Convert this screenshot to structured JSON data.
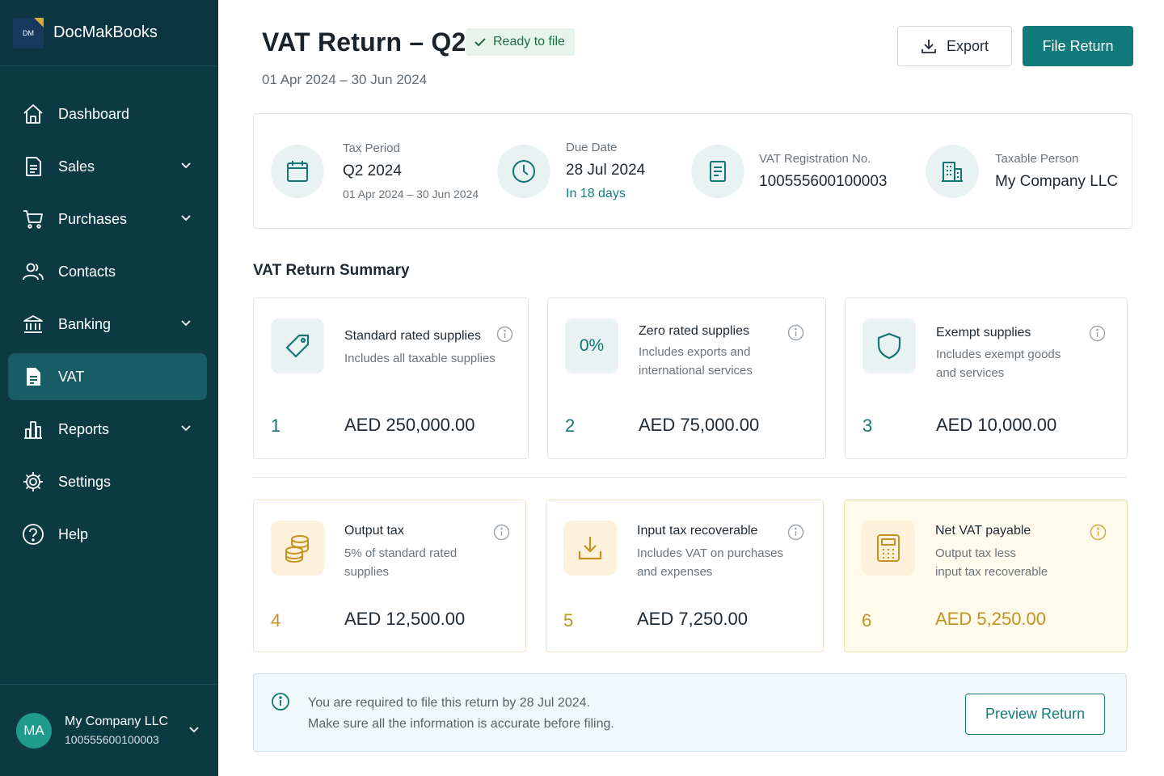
{
  "brand": {
    "logo_text": "DM",
    "name": "DocMakBooks"
  },
  "sidebar": {
    "items": [
      {
        "label": "Dashboard",
        "icon": "home-icon"
      },
      {
        "label": "Sales",
        "icon": "document-icon",
        "has_submenu": true
      },
      {
        "label": "Purchases",
        "icon": "cart-icon",
        "has_submenu": true
      },
      {
        "label": "Contacts",
        "icon": "users-icon"
      },
      {
        "label": "Banking",
        "icon": "bank-icon",
        "has_submenu": true
      },
      {
        "label": "VAT",
        "icon": "file-icon",
        "active": true
      },
      {
        "label": "Reports",
        "icon": "bar-chart-icon",
        "has_submenu": true
      },
      {
        "label": "Settings",
        "icon": "gear-icon"
      },
      {
        "label": "Help",
        "icon": "help-icon"
      }
    ],
    "user": {
      "initials": "MA",
      "name": "My Company LLC",
      "trn": "100555600100003"
    }
  },
  "header": {
    "title": "VAT Return – Q2",
    "status": "Ready to file",
    "period": "01 Apr 2024 – 30 Jun 2024",
    "export_label": "Export",
    "file_label": "File Return"
  },
  "info": {
    "tax_period": {
      "label": "Tax Period",
      "value": "Q2 2024",
      "sub": "01 Apr 2024 – 30 Jun 2024"
    },
    "due_date": {
      "label": "Due Date",
      "value": "28 Jul 2024",
      "sub": "In 18 days"
    },
    "vat_reg": {
      "label": "VAT Registration No.",
      "value": "100555600100003"
    },
    "taxable_person": {
      "label": "Taxable Person",
      "value": "My Company LLC"
    }
  },
  "summary": {
    "title": "VAT Return Summary",
    "cards": [
      {
        "num": "1",
        "title": "Standard rated supplies",
        "desc1": "Includes all taxable supplies",
        "desc2": "",
        "currency": "AED",
        "amount": "250,000.00"
      },
      {
        "num": "2",
        "title": "Zero rated supplies",
        "desc1": "Includes exports and",
        "desc2": "international services",
        "icon_text": "0%",
        "currency": "AED",
        "amount": "75,000.00"
      },
      {
        "num": "3",
        "title": "Exempt supplies",
        "desc1": "Includes exempt goods",
        "desc2": "and services",
        "currency": "AED",
        "amount": "10,000.00"
      },
      {
        "num": "4",
        "title": "Output tax",
        "desc1": "5% of standard rated",
        "desc2": "supplies",
        "currency": "AED",
        "amount": "12,500.00"
      },
      {
        "num": "5",
        "title": "Input tax recoverable",
        "desc1": "Includes VAT on purchases",
        "desc2": "and expenses",
        "currency": "AED",
        "amount": "7,250.00"
      },
      {
        "num": "6",
        "title": "Net VAT payable",
        "desc1": "Output tax less",
        "desc2": "input tax recoverable",
        "currency": "AED",
        "amount": "5,250.00"
      }
    ]
  },
  "notice": {
    "line1": "You are required to file this return by 28 Jul 2024.",
    "line2": "Make sure all the information is accurate before filing.",
    "button": "Preview Return"
  },
  "colors": {
    "sidebar_bg": "#0c3a43",
    "sidebar_active": "#1a5c65",
    "accent": "#117a7a",
    "warm_accent": "#c59221",
    "status_green": "#1f6b42"
  }
}
